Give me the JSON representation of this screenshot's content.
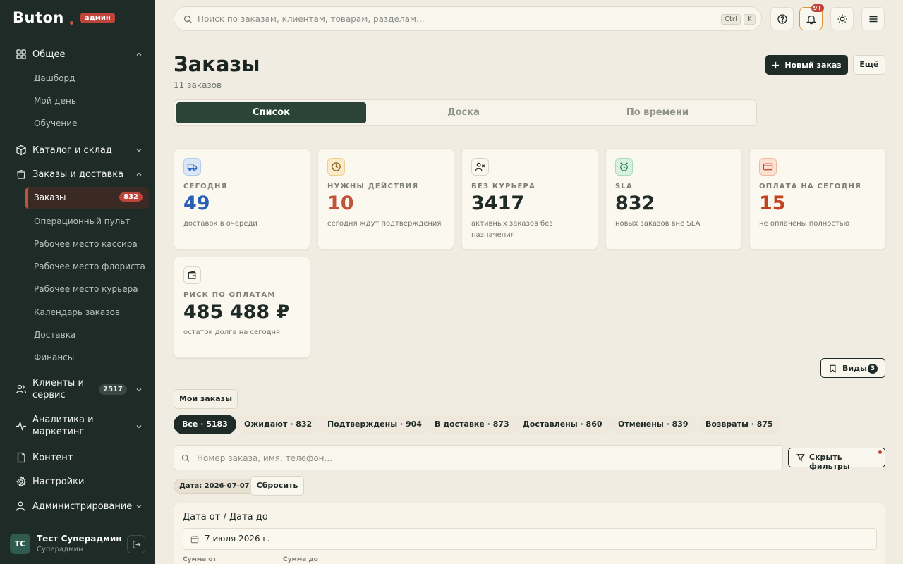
{
  "sidebar": {
    "brand": "Buton",
    "badge": "админ",
    "groups": [
      {
        "label": "Общее",
        "items": [
          "Дашборд",
          "Мой день",
          "Обучение"
        ]
      },
      {
        "label": "Каталог и склад"
      },
      {
        "label": "Заказы и доставка",
        "active_item": {
          "label": "Заказы",
          "count": "832"
        },
        "items": [
          "Операционный пульт",
          "Рабочее место кассира",
          "Рабочее место флориста",
          "Рабочее место курьера",
          "Календарь заказов",
          "Доставка",
          "Финансы"
        ]
      },
      {
        "label_line1": "Клиенты и",
        "label_line2": "сервис",
        "count": "2517"
      },
      {
        "label_line1": "Аналитика и",
        "label_line2": "маркетинг"
      },
      {
        "label": "Контент"
      },
      {
        "label": "Настройки"
      },
      {
        "label": "Администрирование"
      }
    ],
    "user": {
      "initials": "ТС",
      "name": "Тест Суперадмин",
      "role": "Суперадмин"
    }
  },
  "topbar": {
    "search_placeholder": "Поиск по заказам, клиентам, товарам, разделам...",
    "kbd1": "Ctrl",
    "kbd2": "K",
    "notif_badge": "9+"
  },
  "header": {
    "title": "Заказы",
    "subtitle": "11 заказов",
    "new_order": "Новый заказ",
    "more": "Ещё"
  },
  "tabs": [
    "Список",
    "Доска",
    "По времени"
  ],
  "cards": [
    {
      "title": "СЕГОДНЯ",
      "value": "49",
      "desc": "доставок в очереди",
      "color": "#2a5fb8"
    },
    {
      "title": "НУЖНЫ ДЕЙСТВИЯ",
      "value": "10",
      "desc": "сегодня ждут подтверждения",
      "color": "#c0543a"
    },
    {
      "title": "БЕЗ КУРЬЕРА",
      "value": "3417",
      "desc": "активных заказов без назначения",
      "color": "#1f2b27"
    },
    {
      "title": "SLA",
      "value": "832",
      "desc": "новых заказов вне SLA",
      "color": "#1f2b27"
    },
    {
      "title": "ОПЛАТА НА СЕГОДНЯ",
      "value": "15",
      "desc": "не оплачены полностью",
      "color": "#c0431f"
    },
    {
      "title": "РИСК ПО ОПЛАТАМ",
      "value": "485 488 ₽",
      "desc": "остаток долга на сегодня",
      "color": "#1f2b27"
    }
  ],
  "views": {
    "label": "Виды",
    "count": "3"
  },
  "my_orders": "Мои заказы",
  "status_pills": [
    "Все · 5183",
    "Ожидают · 832",
    "Подтверждены · 904",
    "В доставке · 873",
    "Доставлены · 860",
    "Отменены · 839",
    "Возвраты · 875"
  ],
  "filter": {
    "search_placeholder": "Номер заказа, имя, телефон...",
    "hide_filters": "Скрыть фильтры",
    "date_chip": "Дата: 2026-07-07",
    "reset": "Сбросить",
    "date_range_label": "Дата от / Дата до",
    "date_value": "7 июля 2026 г.",
    "sum_from": "Сумма от",
    "sum_to": "Сумма до"
  }
}
